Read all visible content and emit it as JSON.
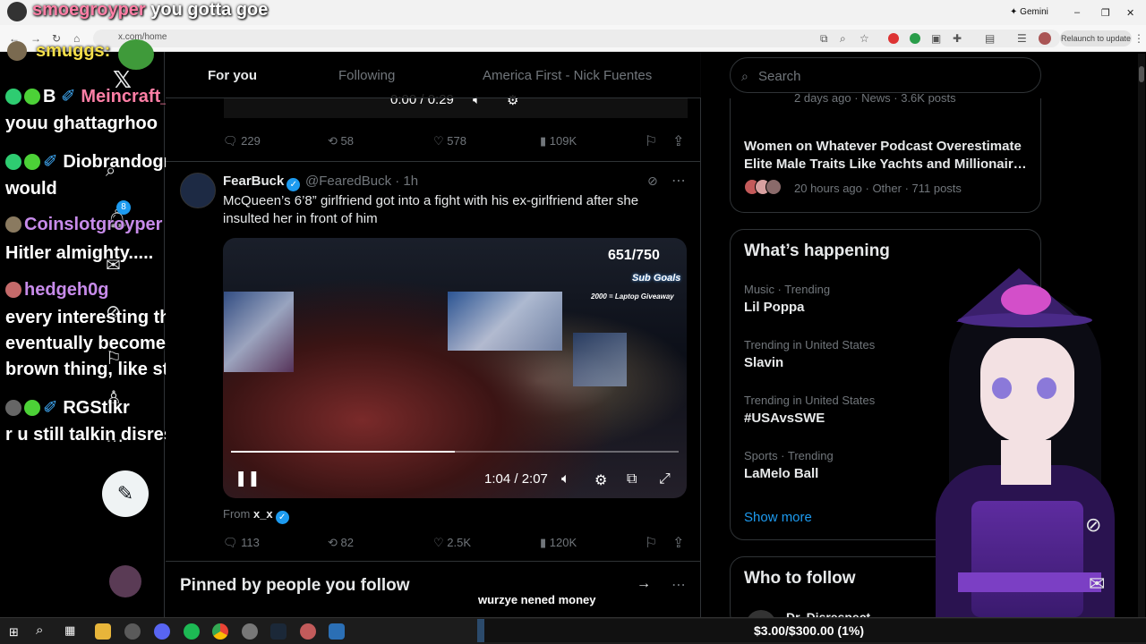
{
  "browser": {
    "address": "x.com/home",
    "gemini_label": "Gemini",
    "relaunch_label": "Relaunch to update"
  },
  "chat": [
    {
      "user": "smoegroyper",
      "message": "you gotta goe"
    },
    {
      "user": "smuggs:",
      "message": ""
    },
    {
      "user": "B",
      "message": ""
    },
    {
      "user": "Meincraft_Respector",
      "message": "youu ghattagrhoo"
    },
    {
      "user": "Diobrandogroyper",
      "message": "would"
    },
    {
      "user": "Coinslotgroyper",
      "message": "Hitler almighty....."
    },
    {
      "user": "hedgeh0g",
      "message": "every interesting thing"
    },
    {
      "user": "",
      "message": "eventually becomes a very"
    },
    {
      "user": "",
      "message": "brown thing, like streaming"
    },
    {
      "user": "RGStlkr",
      "message": "r u still talkin disrespectin"
    }
  ],
  "nav": {
    "notification_count": "8"
  },
  "timeline": {
    "tabs": [
      "For you",
      "Following",
      "America First - Nick Fuentes"
    ],
    "prev_video_time": "0:00 / 0:29",
    "prev_post": {
      "replies": "229",
      "reposts": "58",
      "likes": "578",
      "views": "109K"
    },
    "post": {
      "name": "FearBuck",
      "handle": "@FearedBuck · 1h",
      "text": "McQueen’s 6’8” girlfriend got into a fight with his ex-girlfriend after she insulted her in front of him",
      "video_counter": "651/750",
      "sub_goals": "Sub Goals",
      "giveaway": "2000 = Laptop Giveaway",
      "video_time": "1:04 / 2:07",
      "progress": 0.5,
      "from_label": "From",
      "from_user": "x_x",
      "replies": "113",
      "reposts": "82",
      "likes": "2.5K",
      "views": "120K"
    },
    "pinned_title": "Pinned by people you follow",
    "overlay_text": "wurzye nened money"
  },
  "sidebar": {
    "search_placeholder": "Search",
    "news_prev_meta": "2 days ago · News · 3.6K posts",
    "news": {
      "title": "Women on Whatever Podcast Overestimate Elite Male Traits Like Yachts and Millionair…",
      "meta": "20 hours ago · Other · 711 posts"
    },
    "whats_happening": "What’s happening",
    "trends": [
      {
        "category": "Music · Trending",
        "name": "Lil Poppa"
      },
      {
        "category": "Trending in United States",
        "name": "Slavin"
      },
      {
        "category": "Trending in United States",
        "name": "#USAvsSWE"
      },
      {
        "category": "Sports · Trending",
        "name": "LaMelo Ball"
      }
    ],
    "show_more": "Show more",
    "who_to_follow": "Who to follow",
    "follow_preview": "Dr. Disrespect"
  },
  "stream": {
    "donation_text": "$3.00/$300.00 (1%)",
    "donation_progress": 0.01
  },
  "colors": {
    "accent": "#1d9bf0",
    "background": "#000000",
    "muted": "#71767b"
  }
}
